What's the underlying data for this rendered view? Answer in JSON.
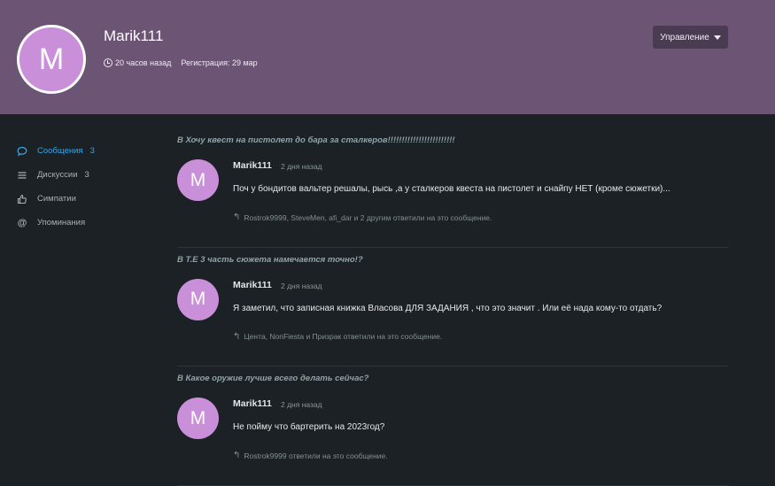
{
  "profile": {
    "avatar_letter": "M",
    "username": "Marik111",
    "last_seen": "20 часов назад",
    "registration": "Регистрация: 29 мар",
    "manage_label": "Управление"
  },
  "colors": {
    "cover": "#6b5474",
    "avatar": "#c98fd8",
    "accent": "#37a6e8",
    "background": "#1b2124"
  },
  "sidebar": {
    "items": [
      {
        "icon": "speech-bubble-icon",
        "label": "Сообщения",
        "count": "3",
        "active": true
      },
      {
        "icon": "list-icon",
        "label": "Дискуссии",
        "count": "3",
        "active": false
      },
      {
        "icon": "thumbs-up-icon",
        "label": "Симпатии",
        "count": "",
        "active": false
      },
      {
        "icon": "at-sign-icon",
        "label": "Упоминания",
        "count": "",
        "active": false
      }
    ]
  },
  "feed": [
    {
      "thread": "В Хочу квест на пистолет до бара за сталкеров!!!!!!!!!!!!!!!!!!!!!!!!",
      "avatar_letter": "M",
      "author": "Marik111",
      "time": "2 дня назад",
      "text": "Поч у бондитов вальтер решалы, рысь ,а у сталкеров квеста на пистолет и снайпу НЕТ (кроме сюжетки)...",
      "replies": "Rostrok9999, SteveMen, afi_dar и 2 другим ответили на это сообщение."
    },
    {
      "thread": "В T.E 3 часть сюжета намечается точно!?",
      "avatar_letter": "M",
      "author": "Marik111",
      "time": "2 дня назад",
      "text": "Я заметил, что записная книжка Власова ДЛЯ ЗАДАНИЯ , что это значит . Или её нада кому-то отдать?",
      "replies": "Цента, NonFiesta и Призрак ответили на это сообщение."
    },
    {
      "thread": "В Какое оружие лучше всего делать сейчас?",
      "avatar_letter": "M",
      "author": "Marik111",
      "time": "2 дня назад",
      "text": "Не пойму что бартерить на 2023год?",
      "replies": "Rostrok9999 ответили на это сообщение."
    }
  ]
}
